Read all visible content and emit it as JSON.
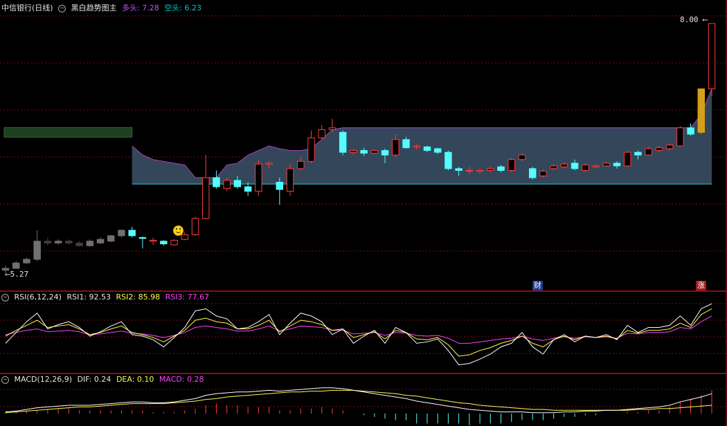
{
  "main_header": {
    "symbol": "中信银行(日线)",
    "indicator": "黑白趋势图主",
    "long_label": "多头: 7.28",
    "short_label": "空头: 6.23"
  },
  "rsi_header": {
    "name": "RSI(6,12,24)",
    "rsi1": "RSI1: 92.53",
    "rsi2": "RSI2: 85.98",
    "rsi3": "RSI3: 77.67"
  },
  "macd_header": {
    "name": "MACD(12,26,9)",
    "dif": "DIF: 0.24",
    "dea": "DEA: 0.10",
    "macd": "MACD: 0.28"
  },
  "price_labels": {
    "high": "8.00",
    "low": "5.27"
  },
  "tags": {
    "cai": "财",
    "zhang": "涨"
  },
  "icons": [
    "collapse-icon",
    "smiley-icon",
    "arrow-left-icon"
  ],
  "colors": {
    "up": "#ff3c3c",
    "down": "#54fcfc",
    "band_fill": "#33465a",
    "band_top": "#b040c0",
    "band_bottom": "#2ec8c8",
    "rsi1": "#ffffff",
    "rsi2": "#ffff50",
    "rsi3": "#ff40ff",
    "limit_up": "#d4a017",
    "grid": "#7a1010"
  },
  "chart_data": {
    "type": "candlestick",
    "price_range": [
      5.27,
      8.0
    ],
    "candles": [
      [
        5.28,
        5.3,
        5.25,
        5.33
      ],
      [
        5.3,
        5.36,
        5.3,
        5.38
      ],
      [
        5.36,
        5.4,
        5.35,
        5.42
      ],
      [
        5.4,
        5.6,
        5.38,
        5.72
      ],
      [
        5.6,
        5.58,
        5.55,
        5.64
      ],
      [
        5.58,
        5.6,
        5.56,
        5.62
      ],
      [
        5.6,
        5.58,
        5.56,
        5.62
      ],
      [
        5.58,
        5.55,
        5.54,
        5.6
      ],
      [
        5.55,
        5.6,
        5.54,
        5.62
      ],
      [
        5.58,
        5.62,
        5.57,
        5.64
      ],
      [
        5.6,
        5.66,
        5.59,
        5.67
      ],
      [
        5.66,
        5.72,
        5.64,
        5.73
      ],
      [
        5.72,
        5.66,
        5.64,
        5.76
      ],
      [
        5.64,
        5.63,
        5.52,
        5.65
      ],
      [
        5.6,
        5.61,
        5.56,
        5.64
      ],
      [
        5.6,
        5.57,
        5.55,
        5.61
      ],
      [
        5.56,
        5.61,
        5.55,
        5.62
      ],
      [
        5.62,
        5.67,
        5.61,
        5.7
      ],
      [
        5.67,
        5.85,
        5.66,
        5.87
      ],
      [
        5.85,
        6.3,
        5.84,
        6.55
      ],
      [
        6.3,
        6.2,
        6.18,
        6.38
      ],
      [
        6.18,
        6.27,
        6.15,
        6.3
      ],
      [
        6.27,
        6.2,
        6.18,
        6.32
      ],
      [
        6.2,
        6.15,
        6.1,
        6.25
      ],
      [
        6.15,
        6.45,
        6.1,
        6.5
      ],
      [
        6.45,
        6.46,
        6.4,
        6.48
      ],
      [
        6.25,
        6.17,
        6.0,
        6.3
      ],
      [
        6.15,
        6.4,
        6.1,
        6.45
      ],
      [
        6.4,
        6.48,
        6.38,
        6.53
      ],
      [
        6.48,
        6.74,
        6.46,
        6.82
      ],
      [
        6.74,
        6.83,
        6.72,
        6.88
      ],
      [
        6.83,
        6.85,
        6.8,
        6.95
      ],
      [
        6.8,
        6.58,
        6.55,
        6.82
      ],
      [
        6.58,
        6.6,
        6.55,
        6.62
      ],
      [
        6.6,
        6.57,
        6.54,
        6.63
      ],
      [
        6.57,
        6.6,
        6.56,
        6.61
      ],
      [
        6.6,
        6.55,
        6.46,
        6.62
      ],
      [
        6.55,
        6.72,
        6.52,
        6.78
      ],
      [
        6.72,
        6.63,
        6.62,
        6.75
      ],
      [
        6.64,
        6.65,
        6.61,
        6.67
      ],
      [
        6.64,
        6.6,
        6.58,
        6.65
      ],
      [
        6.62,
        6.58,
        6.56,
        6.63
      ],
      [
        6.58,
        6.4,
        6.38,
        6.6
      ],
      [
        6.4,
        6.38,
        6.32,
        6.42
      ],
      [
        6.38,
        6.38,
        6.34,
        6.42
      ],
      [
        6.37,
        6.38,
        6.34,
        6.4
      ],
      [
        6.38,
        6.4,
        6.36,
        6.42
      ],
      [
        6.42,
        6.38,
        6.36,
        6.44
      ],
      [
        6.38,
        6.5,
        6.36,
        6.52
      ],
      [
        6.5,
        6.55,
        6.48,
        6.57
      ],
      [
        6.4,
        6.3,
        6.28,
        6.42
      ],
      [
        6.32,
        6.37,
        6.3,
        6.39
      ],
      [
        6.4,
        6.43,
        6.38,
        6.45
      ],
      [
        6.42,
        6.45,
        6.4,
        6.47
      ],
      [
        6.46,
        6.4,
        6.38,
        6.5
      ],
      [
        6.38,
        6.44,
        6.36,
        6.46
      ],
      [
        6.42,
        6.43,
        6.4,
        6.45
      ],
      [
        6.43,
        6.46,
        6.42,
        6.48
      ],
      [
        6.46,
        6.43,
        6.4,
        6.48
      ],
      [
        6.43,
        6.58,
        6.42,
        6.6
      ],
      [
        6.58,
        6.55,
        6.5,
        6.6
      ],
      [
        6.55,
        6.62,
        6.54,
        6.64
      ],
      [
        6.6,
        6.63,
        6.58,
        6.65
      ],
      [
        6.62,
        6.66,
        6.6,
        6.68
      ],
      [
        6.65,
        6.85,
        6.64,
        6.87
      ],
      [
        6.85,
        6.78,
        6.76,
        6.9
      ],
      [
        6.8,
        7.28,
        6.78,
        7.28
      ],
      [
        7.28,
        8.0,
        7.2,
        8.0
      ]
    ],
    "band_top": [
      6.8,
      6.8,
      6.8,
      6.8,
      6.8,
      6.8,
      6.8,
      6.8,
      6.8,
      6.8,
      6.8,
      6.8,
      6.65,
      6.55,
      6.5,
      6.48,
      6.46,
      6.44,
      6.3,
      6.3,
      6.3,
      6.44,
      6.46,
      6.55,
      6.6,
      6.65,
      6.62,
      6.6,
      6.6,
      6.62,
      6.72,
      6.83,
      6.85,
      6.85,
      6.85,
      6.85,
      6.85,
      6.85,
      6.85,
      6.85,
      6.85,
      6.85,
      6.85,
      6.85,
      6.85,
      6.85,
      6.85,
      6.85,
      6.85,
      6.85,
      6.85,
      6.85,
      6.85,
      6.85,
      6.85,
      6.85,
      6.85,
      6.85,
      6.85,
      6.85,
      6.85,
      6.85,
      6.85,
      6.85,
      6.85,
      6.85,
      7.0,
      7.28
    ],
    "band_bottom": [
      6.23,
      6.23,
      6.23,
      6.23,
      6.23,
      6.23,
      6.23,
      6.23,
      6.23,
      6.23,
      6.23,
      6.23,
      6.23,
      6.23,
      6.23,
      6.23,
      6.23,
      6.23,
      6.23,
      6.23,
      6.23,
      6.23,
      6.23,
      6.23,
      6.23,
      6.23,
      6.23,
      6.23,
      6.23,
      6.23,
      6.23,
      6.23,
      6.23,
      6.23,
      6.23,
      6.23,
      6.23,
      6.23,
      6.23,
      6.23,
      6.23,
      6.23,
      6.23,
      6.23,
      6.23,
      6.23,
      6.23,
      6.23,
      6.23,
      6.23,
      6.23,
      6.23,
      6.23,
      6.23,
      6.23,
      6.23,
      6.23,
      6.23,
      6.23,
      6.23,
      6.23,
      6.23,
      6.23,
      6.23,
      6.23,
      6.23,
      6.23,
      6.23
    ],
    "rsi1": [
      40,
      55,
      70,
      82,
      60,
      66,
      70,
      62,
      50,
      56,
      64,
      70,
      52,
      50,
      45,
      35,
      48,
      62,
      85,
      88,
      78,
      74,
      60,
      62,
      70,
      80,
      52,
      68,
      82,
      78,
      70,
      52,
      60,
      40,
      50,
      58,
      40,
      62,
      55,
      40,
      42,
      46,
      30,
      10,
      12,
      18,
      25,
      35,
      40,
      55,
      35,
      25,
      45,
      52,
      42,
      50,
      48,
      52,
      45,
      65,
      55,
      62,
      62,
      65,
      78,
      65,
      88,
      95
    ],
    "rsi2": [
      50,
      58,
      65,
      72,
      62,
      64,
      66,
      60,
      52,
      55,
      60,
      64,
      55,
      52,
      48,
      42,
      50,
      58,
      72,
      75,
      70,
      68,
      60,
      60,
      65,
      72,
      56,
      64,
      72,
      70,
      66,
      58,
      60,
      48,
      52,
      56,
      46,
      58,
      55,
      46,
      45,
      48,
      38,
      22,
      24,
      30,
      34,
      40,
      44,
      50,
      40,
      35,
      45,
      50,
      45,
      50,
      48,
      50,
      46,
      58,
      54,
      58,
      58,
      60,
      68,
      62,
      80,
      88
    ],
    "rsi3": [
      52,
      55,
      58,
      60,
      56,
      57,
      58,
      56,
      52,
      53,
      55,
      57,
      54,
      53,
      51,
      48,
      51,
      55,
      62,
      64,
      62,
      60,
      57,
      57,
      60,
      64,
      57,
      60,
      64,
      63,
      62,
      58,
      58,
      53,
      54,
      55,
      51,
      55,
      54,
      51,
      50,
      51,
      47,
      40,
      40,
      42,
      44,
      46,
      47,
      50,
      46,
      44,
      47,
      49,
      47,
      49,
      48,
      49,
      47,
      54,
      53,
      55,
      55,
      56,
      62,
      60,
      70,
      78
    ],
    "macd_dif": [
      0.02,
      0.03,
      0.05,
      0.07,
      0.08,
      0.09,
      0.1,
      0.1,
      0.1,
      0.11,
      0.12,
      0.13,
      0.14,
      0.14,
      0.13,
      0.13,
      0.14,
      0.16,
      0.18,
      0.22,
      0.24,
      0.25,
      0.26,
      0.26,
      0.27,
      0.28,
      0.27,
      0.28,
      0.29,
      0.3,
      0.31,
      0.31,
      0.3,
      0.28,
      0.26,
      0.24,
      0.22,
      0.2,
      0.18,
      0.15,
      0.13,
      0.11,
      0.09,
      0.07,
      0.05,
      0.04,
      0.03,
      0.02,
      0.02,
      0.02,
      0.01,
      0.01,
      0.01,
      0.02,
      0.02,
      0.03,
      0.03,
      0.04,
      0.04,
      0.05,
      0.06,
      0.07,
      0.08,
      0.1,
      0.14,
      0.17,
      0.2,
      0.24
    ],
    "macd_dea": [
      0.01,
      0.02,
      0.03,
      0.04,
      0.05,
      0.06,
      0.07,
      0.08,
      0.08,
      0.09,
      0.1,
      0.11,
      0.12,
      0.12,
      0.12,
      0.12,
      0.13,
      0.14,
      0.15,
      0.17,
      0.18,
      0.2,
      0.21,
      0.22,
      0.23,
      0.24,
      0.25,
      0.26,
      0.26,
      0.27,
      0.27,
      0.28,
      0.28,
      0.28,
      0.27,
      0.26,
      0.25,
      0.24,
      0.22,
      0.21,
      0.19,
      0.17,
      0.15,
      0.13,
      0.12,
      0.1,
      0.09,
      0.08,
      0.07,
      0.06,
      0.05,
      0.05,
      0.04,
      0.04,
      0.04,
      0.04,
      0.04,
      0.04,
      0.04,
      0.04,
      0.05,
      0.05,
      0.06,
      0.06,
      0.07,
      0.08,
      0.09,
      0.1
    ],
    "macd_hist": [
      0.02,
      0.02,
      0.03,
      0.04,
      0.05,
      0.06,
      0.06,
      0.04,
      0.04,
      0.04,
      0.04,
      0.04,
      0.04,
      0.04,
      0.02,
      0.02,
      0.02,
      0.04,
      0.06,
      0.1,
      0.12,
      0.1,
      0.1,
      0.08,
      0.08,
      0.08,
      0.04,
      0.04,
      0.06,
      0.06,
      0.08,
      0.06,
      0.04,
      0.0,
      -0.02,
      -0.04,
      -0.06,
      -0.08,
      -0.08,
      -0.12,
      -0.12,
      -0.12,
      -0.12,
      -0.12,
      -0.14,
      -0.12,
      -0.12,
      -0.12,
      -0.1,
      -0.08,
      -0.08,
      -0.08,
      -0.06,
      -0.04,
      -0.04,
      -0.02,
      -0.02,
      0.0,
      0.0,
      0.02,
      0.02,
      0.04,
      0.04,
      0.08,
      0.14,
      0.18,
      0.22,
      0.28
    ]
  }
}
